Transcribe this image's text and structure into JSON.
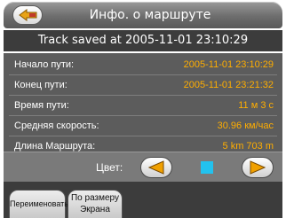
{
  "window": {
    "title": "Инфо. о маршруте",
    "back_icon": "back-arrow-icon"
  },
  "status": {
    "text": "Track saved at 2005-11-01 23:10:29"
  },
  "info": {
    "rows": [
      {
        "label": "Начало пути:",
        "value": "2005-11-01 23:10:29"
      },
      {
        "label": "Конец пути:",
        "value": "2005-11-01 23:21:32"
      },
      {
        "label": "Время пути:",
        "value": "11 м  3 с"
      },
      {
        "label": "Средняя скорость:",
        "value": "30.96 км/час"
      },
      {
        "label": "Длина Маршрута:",
        "value": "5 km 703 m"
      }
    ]
  },
  "color": {
    "label": "Цвет:",
    "selected_color": "#22c2ee",
    "prev_icon": "arrow-left-icon",
    "next_icon": "arrow-right-icon"
  },
  "tabs": {
    "rename_label": "Переименовать",
    "fit_line1": "По размеру",
    "fit_line2": "Экрана"
  },
  "colors": {
    "accent": "#ffae00",
    "title_bar": "#6d6d6d",
    "panel": "#5c5c5c",
    "arrow_fill": "#f0a000"
  }
}
